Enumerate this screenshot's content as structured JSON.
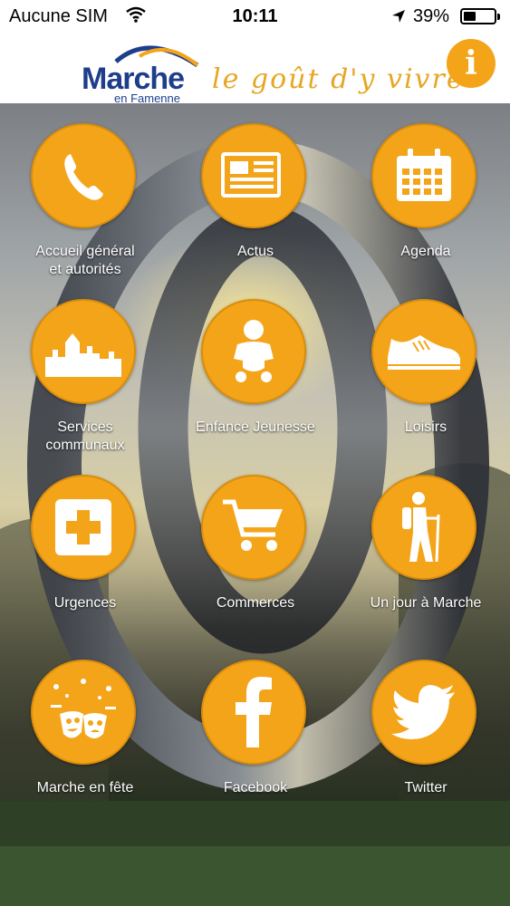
{
  "status_bar": {
    "carrier": "Aucune SIM",
    "time": "10:11",
    "battery": "39%"
  },
  "header": {
    "logo_name": "Marche",
    "logo_sub": "en Famenne",
    "tagline": "le goût d'y vivre",
    "info_label": "i"
  },
  "colors": {
    "accent": "#f4a419",
    "brand_blue": "#1e3e8c"
  },
  "tiles": [
    {
      "label": "Accueil général\net autorités",
      "icon": "phone-icon"
    },
    {
      "label": "Actus",
      "icon": "newspaper-icon"
    },
    {
      "label": "Agenda",
      "icon": "calendar-icon"
    },
    {
      "label": "Services\ncommunaux",
      "icon": "town-skyline-icon"
    },
    {
      "label": "Enfance Jeunesse",
      "icon": "baby-icon"
    },
    {
      "label": "Loisirs",
      "icon": "sneaker-icon"
    },
    {
      "label": "Urgences",
      "icon": "first-aid-icon"
    },
    {
      "label": "Commerces",
      "icon": "shopping-cart-icon"
    },
    {
      "label": "Un jour à Marche",
      "icon": "hiker-icon"
    },
    {
      "label": "Marche en fête",
      "icon": "theater-masks-icon"
    },
    {
      "label": "Facebook",
      "icon": "facebook-icon"
    },
    {
      "label": "Twitter",
      "icon": "twitter-bird-icon"
    }
  ]
}
